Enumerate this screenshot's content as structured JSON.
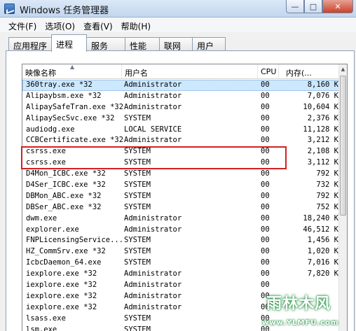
{
  "window": {
    "title": "Windows 任务管理器",
    "buttons": {
      "minimize": "—",
      "maximize": "□",
      "close": "✕"
    }
  },
  "menu": [
    {
      "label": "文件(F)"
    },
    {
      "label": "选项(O)"
    },
    {
      "label": "查看(V)"
    },
    {
      "label": "帮助(H)"
    }
  ],
  "tabs": [
    {
      "label": "应用程序"
    },
    {
      "label": "进程"
    },
    {
      "label": "服务"
    },
    {
      "label": "性能"
    },
    {
      "label": "联网"
    },
    {
      "label": "用户"
    }
  ],
  "active_tab": "进程",
  "columns": {
    "name": "映像名称",
    "user": "用户名",
    "cpu": "CPU",
    "memory": "内存(..."
  },
  "processes": [
    {
      "name": "360tray.exe *32",
      "user": "Administrator",
      "cpu": "00",
      "memory": "8,160 K"
    },
    {
      "name": "Alipaybsm.exe *32",
      "user": "Administrator",
      "cpu": "00",
      "memory": "7,076 K"
    },
    {
      "name": "AlipaySafeTran.exe *32",
      "user": "Administrator",
      "cpu": "00",
      "memory": "10,604 K"
    },
    {
      "name": "AlipaySecSvc.exe *32",
      "user": "SYSTEM",
      "cpu": "00",
      "memory": "2,376 K"
    },
    {
      "name": "audiodg.exe",
      "user": "LOCAL SERVICE",
      "cpu": "00",
      "memory": "11,128 K"
    },
    {
      "name": "CCBCertificate.exe *32",
      "user": "Administrator",
      "cpu": "00",
      "memory": "3,212 K"
    },
    {
      "name": "csrss.exe",
      "user": "SYSTEM",
      "cpu": "00",
      "memory": "2,108 K"
    },
    {
      "name": "csrss.exe",
      "user": "SYSTEM",
      "cpu": "00",
      "memory": "3,112 K"
    },
    {
      "name": "D4Mon_ICBC.exe *32",
      "user": "SYSTEM",
      "cpu": "00",
      "memory": "792 K"
    },
    {
      "name": "D4Ser_ICBC.exe *32",
      "user": "SYSTEM",
      "cpu": "00",
      "memory": "732 K"
    },
    {
      "name": "DBMon_ABC.exe *32",
      "user": "SYSTEM",
      "cpu": "00",
      "memory": "792 K"
    },
    {
      "name": "DBSer_ABC.exe *32",
      "user": "SYSTEM",
      "cpu": "00",
      "memory": "752 K"
    },
    {
      "name": "dwm.exe",
      "user": "Administrator",
      "cpu": "00",
      "memory": "18,240 K"
    },
    {
      "name": "explorer.exe",
      "user": "Administrator",
      "cpu": "00",
      "memory": "46,512 K"
    },
    {
      "name": "FNPLicensingService...",
      "user": "SYSTEM",
      "cpu": "00",
      "memory": "1,456 K"
    },
    {
      "name": "HZ_CommSrv.exe *32",
      "user": "SYSTEM",
      "cpu": "00",
      "memory": "1,020 K"
    },
    {
      "name": "IcbcDaemon_64.exe",
      "user": "SYSTEM",
      "cpu": "00",
      "memory": "7,016 K"
    },
    {
      "name": "iexplore.exe *32",
      "user": "Administrator",
      "cpu": "00",
      "memory": "7,820 K"
    },
    {
      "name": "iexplore.exe *32",
      "user": "Administrator",
      "cpu": "00",
      "memory": ""
    },
    {
      "name": "iexplore.exe *32",
      "user": "Administrator",
      "cpu": "00",
      "memory": ""
    },
    {
      "name": "iexplore.exe *32",
      "user": "Administrator",
      "cpu": "00",
      "memory": ""
    },
    {
      "name": "lsass.exe",
      "user": "SYSTEM",
      "cpu": "00",
      "memory": ""
    },
    {
      "name": "lsm.exe",
      "user": "SYSTEM",
      "cpu": "00",
      "memory": ""
    }
  ],
  "selected_index": 0,
  "watermark": {
    "text": "雨林木风",
    "url": "www.YLMFU.com"
  },
  "colors": {
    "highlight_box": "#d22121",
    "selection": "#cce8ff"
  }
}
